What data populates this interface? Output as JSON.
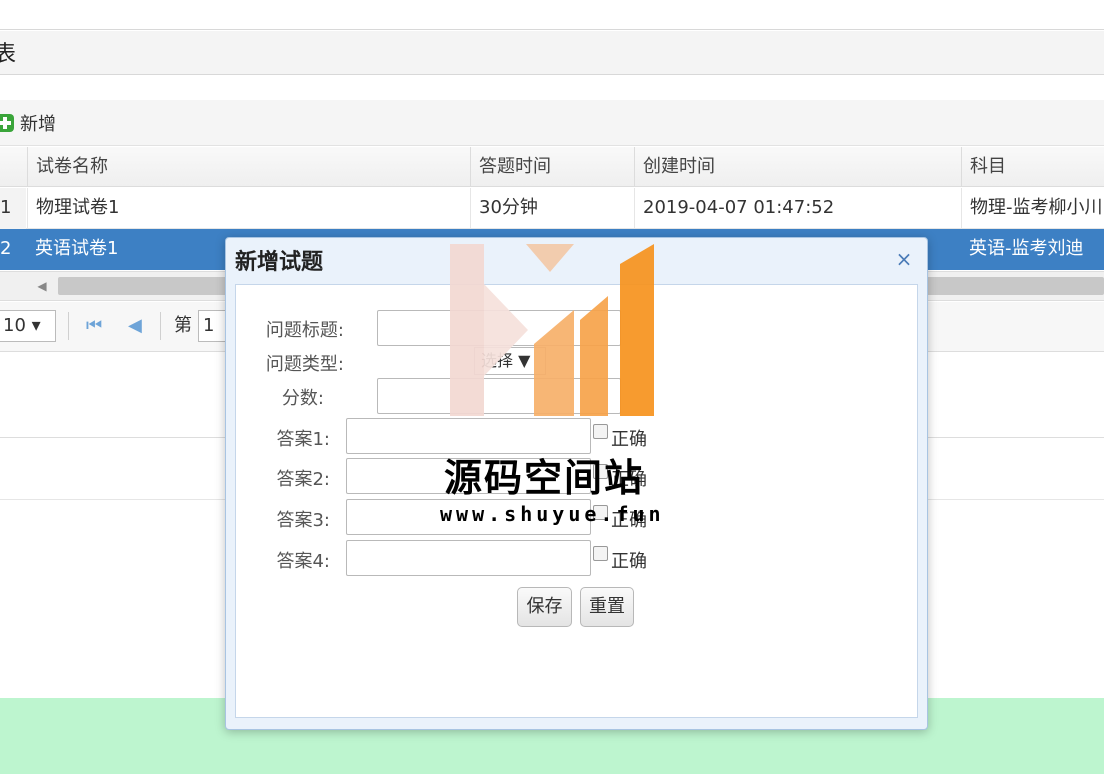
{
  "panel": {
    "title": "表"
  },
  "toolbar": {
    "add_label": "新增"
  },
  "grid": {
    "columns": [
      "试卷名称",
      "答题时间",
      "创建时间",
      "科目"
    ],
    "rows": [
      {
        "num": "1",
        "name": "物理试卷1",
        "time": "30分钟",
        "created": "2019-04-07 01:47:52",
        "subject": "物理-监考柳小川"
      },
      {
        "num": "2",
        "name": "英语试卷1",
        "time": "",
        "created": "",
        "subject": "英语-监考刘迪"
      }
    ]
  },
  "pager": {
    "page_size": "10",
    "page_label": "第",
    "page_value": "1"
  },
  "modal": {
    "title": "新增试题",
    "close_glyph": "×",
    "fields": {
      "question_title_label": "问题标题:",
      "question_type_label": "问题类型:",
      "question_type_value": "选择",
      "score_label": "分数:",
      "answers": [
        {
          "label": "答案1:",
          "correct_label": "正确"
        },
        {
          "label": "答案2:",
          "correct_label": "正确"
        },
        {
          "label": "答案3:",
          "correct_label": "正确"
        },
        {
          "label": "答案4:",
          "correct_label": "正确"
        }
      ]
    },
    "buttons": {
      "save": "保存",
      "reset": "重置"
    }
  },
  "watermark": {
    "name": "源码空间站",
    "url": "www.shuyue.fun"
  },
  "colors": {
    "selected_row": "#3d80c4",
    "footer": "#bdf5cf",
    "watermark_orange": "#f7931e",
    "watermark_pink": "#f3c9c2"
  }
}
